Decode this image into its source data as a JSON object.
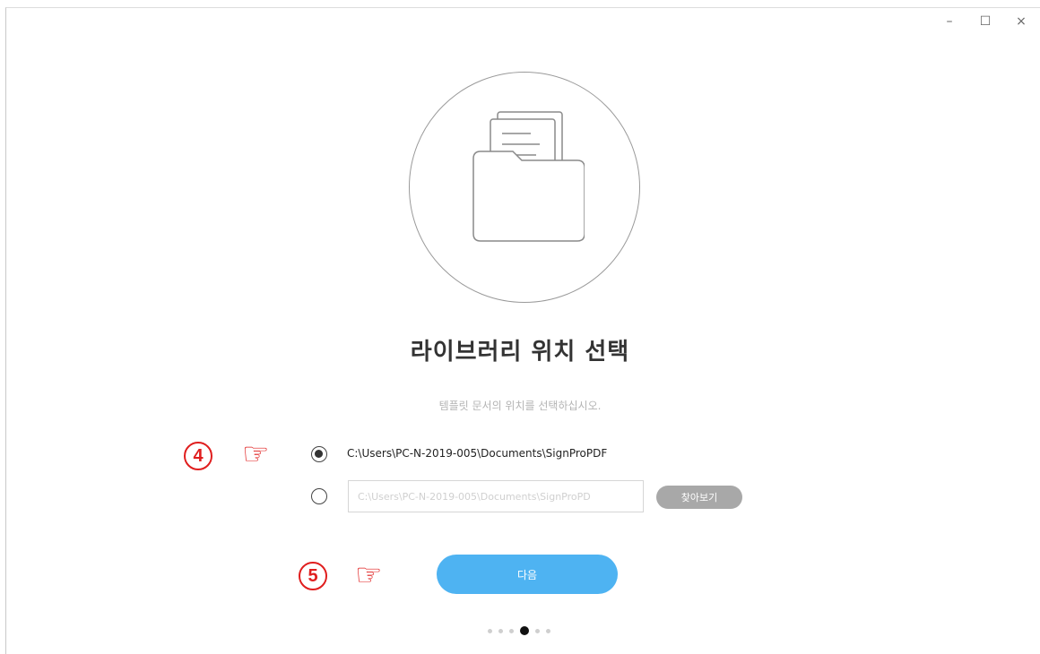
{
  "window": {
    "controls": {
      "minimize": "–",
      "maximize": "☐",
      "close": "×"
    }
  },
  "hero": {
    "icon": "folder-with-documents-icon"
  },
  "title": "라이브러리 위치 선택",
  "subtitle": "템플릿 문서의 위치를 선택하십시오.",
  "annotations": {
    "step4": "4",
    "step5": "5",
    "pointer_icon": "pointing-hand-icon"
  },
  "options": {
    "default_path": "C:\\Users\\PC-N-2019-005\\Documents\\SignProPDF",
    "default_selected": true,
    "custom_path_placeholder": "C:\\Users\\PC-N-2019-005\\Documents\\SignProPD",
    "custom_selected": false,
    "browse_label": "찾아보기"
  },
  "next_label": "다음",
  "pager": {
    "total": 6,
    "current": 4
  },
  "colors": {
    "accent": "#4eb3f2",
    "annotation": "#e01e1e",
    "browse": "#a8a8a8"
  }
}
